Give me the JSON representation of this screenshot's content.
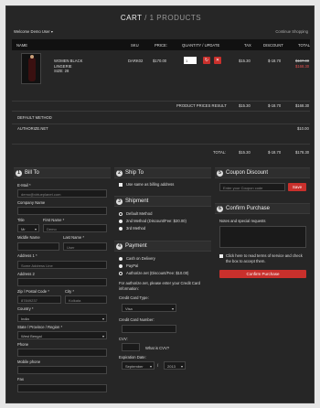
{
  "cart": {
    "title": "CART",
    "divider": "/",
    "count": "1 PRODUCTS"
  },
  "top": {
    "welcome": "Welcome Demo User",
    "dropdown_arrow": "▾",
    "continue": "Continue Shopping"
  },
  "table": {
    "headers": {
      "name": "NAME",
      "sku": "SKU",
      "price": "PRICE:",
      "qty": "QUANTITY / UPDATE",
      "tax": "TAX",
      "discount": "DISCOUNT",
      "total": "TOTAL"
    },
    "item": {
      "name_line1": "WOMEN BLACK",
      "name_line2": "LINGERIE",
      "name_line3": "SIZE: 28",
      "sku": "DARK02",
      "price": "$170.00",
      "qty": "1",
      "tax": "$15.30",
      "discount": "$-18.70",
      "total_old": "$187.00",
      "total_new": "$168.30"
    },
    "product_prices_label": "PRODUCT PRICES RESULT",
    "pp_tax": "$15.30",
    "pp_discount": "$-18.70",
    "pp_total": "$168.30",
    "default_method": "DEFAULT METHOD",
    "authorize_label": "AUTHORIZE.NET",
    "authorize_total": "$10.00",
    "total_label": "TOTAL:",
    "t_tax": "$15.30",
    "t_discount": "$-18.70",
    "t_total": "$178.30"
  },
  "bill": {
    "num": "1",
    "title": "Bill To",
    "email_label": "E-Mail *",
    "email_value": "demo@virtueplanet.com",
    "company_label": "Company Name",
    "title_label": "Title",
    "title_value": "Mr",
    "firstname_label": "First Name *",
    "firstname_value": "Demo",
    "middlename_label": "Middle Name",
    "lastname_label": "Last Name *",
    "lastname_value": "User",
    "address1_label": "Address 1 *",
    "address1_placeholder": "Some Address Line",
    "address2_label": "Address 2",
    "zip_label": "Zip / Postal Code *",
    "zip_value": "87849237",
    "city_label": "City *",
    "city_value": "Kolkata",
    "country_label": "Country *",
    "country_value": "India",
    "state_label": "State / Province / Region *",
    "state_value": "West Bengal",
    "phone_label": "Phone",
    "mobile_label": "Mobile phone",
    "fax_label": "Fax"
  },
  "ship": {
    "num": "2",
    "title": "Ship To",
    "same_label": "Use same as billing address"
  },
  "shipment": {
    "num": "3",
    "title": "Shipment",
    "options": [
      "Default Method",
      "2nd Method (Discount/Fee: $20.00)",
      "3rd Method"
    ]
  },
  "payment": {
    "num": "4",
    "title": "Payment",
    "options": [
      "Cash on Delivery",
      "PayPal",
      "Authorize.net (Discount/Fee: $10.00)"
    ],
    "info": "For authorize.net, please enter your Credit Card information:",
    "card_type_label": "Credit Card Type:",
    "card_type_value": "Visa",
    "card_number_label": "Credit Card Number:",
    "cvv_label": "CVV:",
    "cvv_help": "What is CVV?",
    "expiry_label": "Expiration Date:",
    "month_value": "September",
    "slash": "/",
    "year_value": "2013"
  },
  "coupon": {
    "num": "5",
    "title": "Coupon Discount",
    "placeholder": "Enter your Coupon code",
    "button": "Save"
  },
  "confirm": {
    "num": "6",
    "title": "Confirm Purchase",
    "notes_label": "Notes and special requests",
    "terms": "Click here to read terms of service and check the box to accept them.",
    "button": "Confirm Purchase"
  },
  "colors": {
    "accent": "#c9302c",
    "background": "#262626",
    "header": "#111111"
  },
  "icons": {
    "select_arrow": "▾",
    "check": "✓",
    "refresh": "↻",
    "delete": "✕"
  }
}
